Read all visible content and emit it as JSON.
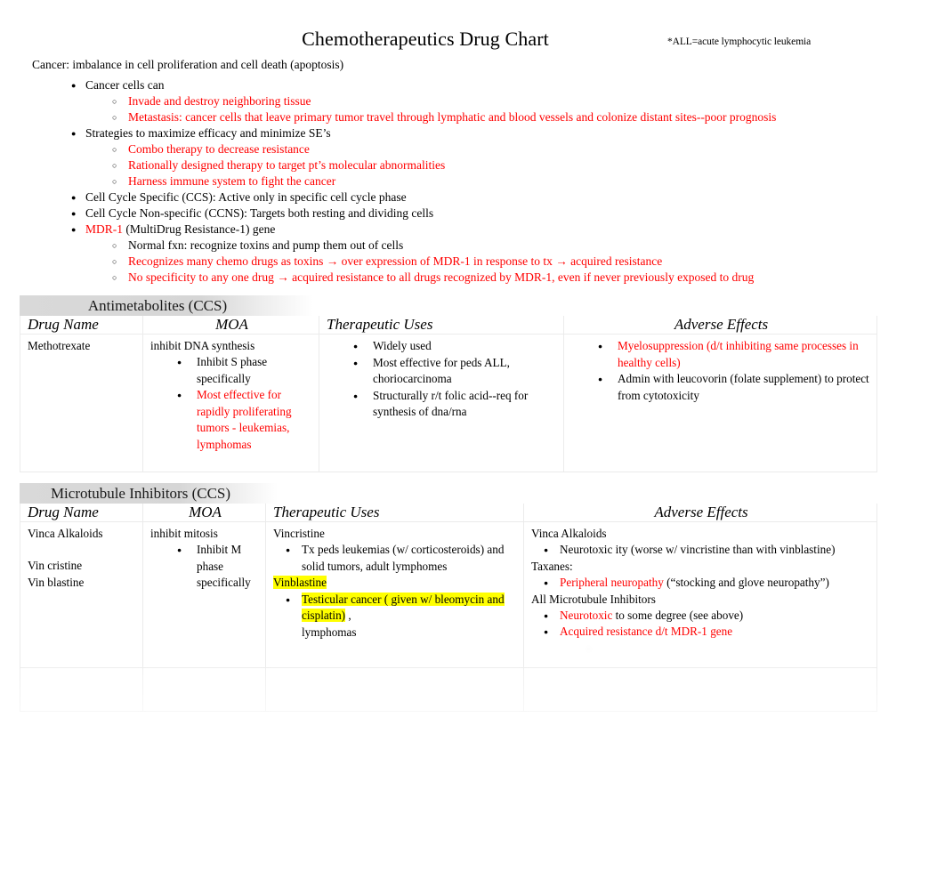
{
  "document": {
    "title": "Chemotherapeutics Drug Chart",
    "footnote": "*ALL=acute lymphocytic leukemia"
  },
  "intro": {
    "lead": "Cancer: imbalance in cell proliferation and cell death (apoptosis)",
    "items": [
      {
        "text": "Cancer cells can",
        "color": "#000000",
        "sub": [
          {
            "text": "Invade and destroy neighboring tissue",
            "color": "#ff0000"
          },
          {
            "text": "Metastasis: cancer cells that leave primary tumor travel through lymphatic and blood vessels and colonize distant sites--poor prognosis",
            "color": "#ff0000"
          }
        ]
      },
      {
        "text": "Strategies to maximize efficacy and minimize SE’s",
        "color": "#000000",
        "sub": [
          {
            "text": "Combo therapy to decrease resistance",
            "color": "#ff0000"
          },
          {
            "text": "Rationally designed therapy to target pt’s molecular abnormalities",
            "color": "#ff0000"
          },
          {
            "text": "Harness immune system to fight the cancer",
            "color": "#ff0000"
          }
        ]
      },
      {
        "text": "Cell Cycle Specific (CCS): Active only in specific cell cycle phase",
        "color": "#000000",
        "sub": []
      },
      {
        "text": "Cell Cycle Non-specific (CCNS): Targets both resting and dividing cells",
        "color": "#000000",
        "sub": []
      }
    ],
    "mdr": {
      "red_part": "MDR-1",
      "black_part": "  (MultiDrug Resistance-1) gene",
      "sub": [
        {
          "text": "Normal fxn: recognize toxins and pump them out of cells",
          "color": "#000000"
        },
        {
          "text": "Recognizes many chemo drugs as toxins → over expression of MDR-1 in response to tx →    acquired resistance",
          "color": "#ff0000"
        },
        {
          "text": "No specificity to any one drug →  acquired resistance      to all drugs recognized by MDR-1, even if never previously exposed to drug",
          "color": "#ff0000"
        }
      ]
    }
  },
  "tables": [
    {
      "id": "antimetabolites",
      "title": "Antimetabolites (CCS)",
      "headers": [
        "Drug Name",
        "MOA",
        "Therapeutic Uses",
        "Adverse Effects"
      ],
      "row": {
        "drug_name": "Methotrexate",
        "moa_lead": "inhibit DNA synthesis",
        "moa_bullets": [
          {
            "text": "Inhibit S phase specifically",
            "color": "#000000"
          },
          {
            "text": "Most effective for rapidly proliferating tumors - leukemias, lymphomas",
            "color": "#ff0000"
          }
        ],
        "uses_bullets": [
          {
            "text": "Widely used",
            "color": "#000000"
          },
          {
            "text": "Most effective for peds ALL, choriocarcinoma",
            "color": "#000000"
          },
          {
            "text": "Structurally r/t folic acid--req for synthesis of dna/rna",
            "color": "#000000"
          }
        ],
        "adverse_bullets": [
          {
            "text": "Myelosuppression (d/t inhibiting same processes in healthy cells)",
            "color": "#ff0000"
          },
          {
            "text": "Admin with leucovorin (folate supplement) to protect from cytotoxicity",
            "color": "#000000"
          }
        ]
      }
    },
    {
      "id": "microtubule",
      "title": "Microtubule Inhibitors (CCS)",
      "headers": [
        "Drug Name",
        "MOA",
        "Therapeutic Uses",
        "Adverse Effects"
      ],
      "row": {
        "drug_group": "Vinca Alkaloids",
        "drug_names": [
          "Vin cristine",
          "Vin blastine"
        ],
        "moa_lead": "inhibit mitosis",
        "moa_bullets": [
          {
            "text": "Inhibit M phase specifically",
            "color": "#000000"
          }
        ],
        "uses_group_1": "Vincristine",
        "uses_bullets_1": [
          {
            "text": "Tx peds leukemias (w/ corticosteroids) and solid tumors, adult lymphomes",
            "color": "#000000"
          }
        ],
        "uses_group_2": "Vinblastine",
        "uses_group_2_highlight": true,
        "uses_bullets_2": [
          {
            "highlight_text": "Testicular cancer ( given w/ bleomycin and cisplatin)",
            "tail_text": "  ,",
            "color": "#000000"
          },
          {
            "text": "lymphomas",
            "color": "#000000",
            "no_bullet": true
          }
        ],
        "adverse_group_1": "Vinca Alkaloids",
        "adverse_bullets_1": [
          {
            "text": "Neurotoxic    ity (worse w/ vincristine than with vinblastine)",
            "color": "#000000"
          }
        ],
        "adverse_group_2": "Taxanes:",
        "adverse_bullets_2": [
          {
            "red_text": "Peripheral neuropathy",
            "black_text": "        (“stocking and glove neuropathy”)"
          }
        ],
        "adverse_group_3": "All Microtubule Inhibitors",
        "adverse_bullets_3": [
          {
            "red_text": "Neurotoxic",
            "black_text": "     to some degree (see above)"
          },
          {
            "red_text": "Acquired resistance d/t MDR-1 gene",
            "black_text": ""
          }
        ]
      }
    }
  ],
  "colors": {
    "accent_red": "#ff0000",
    "highlight_yellow": "#ffff00",
    "title_bar_gray": "#d4d4d4",
    "table_border": "#ebebeb"
  }
}
